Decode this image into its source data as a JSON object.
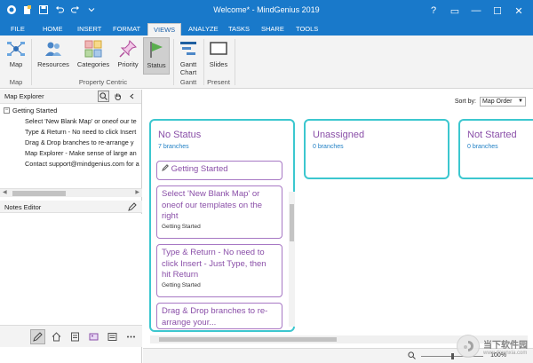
{
  "window": {
    "title": "Welcome* - MindGenius 2019",
    "controls": {
      "help": "?",
      "restore": "▭",
      "minimize": "—",
      "maximize": "☐",
      "close": "✕"
    }
  },
  "tabs": [
    {
      "label": "FILE"
    },
    {
      "label": "HOME"
    },
    {
      "label": "INSERT"
    },
    {
      "label": "FORMAT"
    },
    {
      "label": "VIEWS"
    },
    {
      "label": "ANALYZE"
    },
    {
      "label": "TASKS"
    },
    {
      "label": "SHARE"
    },
    {
      "label": "TOOLS"
    }
  ],
  "ribbon": {
    "buttons": {
      "map": "Map",
      "resources": "Resources",
      "categories": "Categories",
      "priority": "Priority",
      "status": "Status",
      "gantt": "Gantt Chart",
      "slides": "Slides"
    },
    "groups": {
      "map": "Map",
      "property_centric": "Property Centric",
      "gantt": "Gantt",
      "present": "Present"
    }
  },
  "map_explorer": {
    "title": "Map Explorer",
    "root": "Getting Started",
    "root_toggle": "−",
    "items": [
      "Select 'New Blank Map' or oneof our te",
      "Type & Return - No need to click Insert",
      "Drag & Drop branches to re-arrange y",
      "Map Explorer - Make sense of large an",
      "Contact support@mindgenius.com for a"
    ]
  },
  "notes_editor": {
    "title": "Notes Editor"
  },
  "sort": {
    "label": "Sort by:",
    "value": "Map Order"
  },
  "columns": [
    {
      "title": "No Status",
      "count": "7 branches",
      "cards": [
        {
          "text": "Getting Started",
          "sub": ""
        },
        {
          "text": "Select 'New Blank Map' or oneof our templates on the right",
          "sub": "Getting Started"
        },
        {
          "text": "Type & Return - No need to click Insert - Just Type, then hit Return",
          "sub": "Getting Started"
        },
        {
          "text": "Drag & Drop branches to re-arrange your...",
          "sub": ""
        }
      ]
    },
    {
      "title": "Unassigned",
      "count": "0 branches"
    },
    {
      "title": "Not Started",
      "count": "0 branches"
    }
  ],
  "status": {
    "zoom": "100%"
  },
  "watermark": {
    "text": "当下软件园",
    "url": "www.downxia.com"
  },
  "colors": {
    "accent": "#1979ca",
    "column_border": "#3cc7cf",
    "card_text": "#8a4fa8",
    "link": "#1f7fc4"
  }
}
